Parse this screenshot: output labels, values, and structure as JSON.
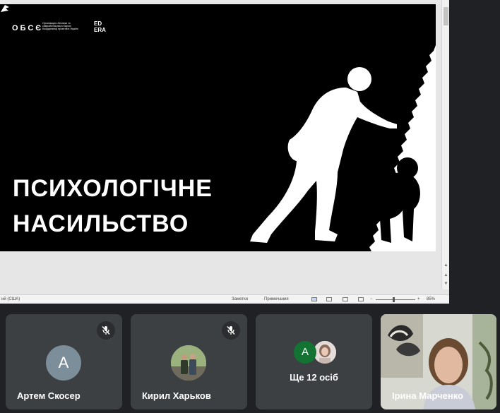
{
  "slide": {
    "logo_osce": "ОБСЄ",
    "logo_osce_sub": "Організація з безпеки та співробітництва в Європі Координатор проектів в Україні",
    "logo_edera": "ED ERA",
    "title_line1": "ПСИХОЛОГІЧНЕ",
    "title_line2": "НАСИЛЬСТВО"
  },
  "statusbar": {
    "language": "ий (США)",
    "notes": "Заметки",
    "comments": "Примечания",
    "zoom": "85%"
  },
  "participants": [
    {
      "name": "Артем Скосер",
      "avatar_letter": "А",
      "muted": true
    },
    {
      "name": "Кирил Харьков",
      "muted": true
    },
    {
      "more_avatar_letter": "А",
      "more_label": "Ще 12 осіб"
    },
    {
      "name": "Ірина Марченко"
    }
  ],
  "colors": {
    "background": "#202124",
    "tile": "#3c4043",
    "avatar_grey": "#7c8e99",
    "avatar_green": "#137333"
  }
}
